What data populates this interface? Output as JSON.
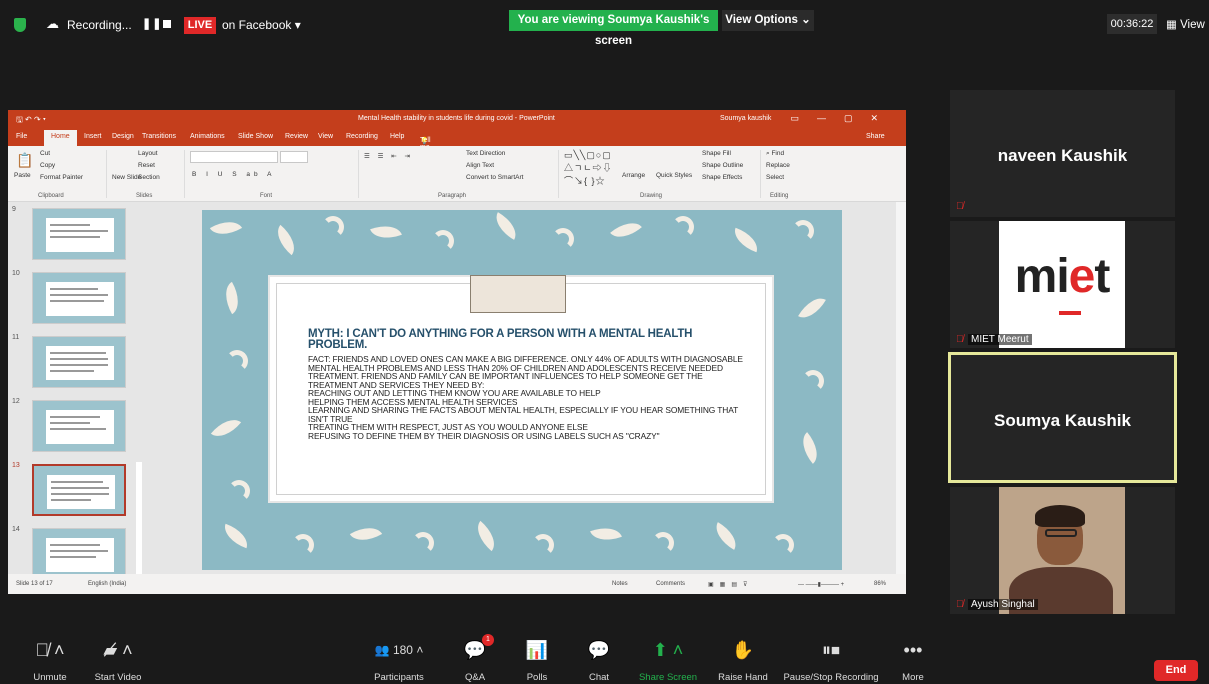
{
  "topbar": {
    "recording_label": "Recording...",
    "live_label": "LIVE",
    "facebook_label": "on Facebook ▾",
    "viewing_banner": "You are viewing Soumya Kaushik's screen",
    "view_options": "View Options ⌄",
    "timer": "00:36:22",
    "view_label": "View"
  },
  "ppt": {
    "doc_title": "Mental Health stability in students life during covid  -  PowerPoint",
    "user": "Soumya kaushik",
    "tabs": [
      "File",
      "Home",
      "Insert",
      "Design",
      "Transitions",
      "Animations",
      "Slide Show",
      "Review",
      "View",
      "Recording",
      "Help"
    ],
    "tell_me": "Tell me what you want to do",
    "share": "Share",
    "ribbon": {
      "cut": "Cut",
      "copy": "Copy",
      "paste": "Paste",
      "format_painter": "Format Painter",
      "new_slide": "New Slide",
      "layout": "Layout",
      "reset": "Reset",
      "section": "Section",
      "text_direction": "Text Direction",
      "align_text": "Align Text",
      "convert_smartart": "Convert to SmartArt",
      "arrange": "Arrange",
      "quick_styles": "Quick Styles",
      "shape_fill": "Shape Fill",
      "shape_outline": "Shape Outline",
      "shape_effects": "Shape Effects",
      "find": "Find",
      "replace": "Replace",
      "select": "Select",
      "groups": [
        "Clipboard",
        "Slides",
        "Font",
        "Paragraph",
        "Drawing",
        "Editing"
      ]
    },
    "slide_numbers": [
      "9",
      "10",
      "11",
      "12",
      "13",
      "14"
    ],
    "slide_title": "MYTH: I CAN'T DO ANYTHING FOR A PERSON WITH A MENTAL HEALTH PROBLEM.",
    "slide_body": [
      "FACT: FRIENDS AND LOVED ONES CAN MAKE A BIG DIFFERENCE. ONLY 44% OF ADULTS WITH DIAGNOSABLE MENTAL HEALTH PROBLEMS AND LESS THAN 20% OF CHILDREN AND ADOLESCENTS RECEIVE NEEDED TREATMENT. FRIENDS AND FAMILY CAN BE IMPORTANT INFLUENCES TO HELP SOMEONE GET THE TREATMENT AND SERVICES THEY NEED BY:",
      "",
      "REACHING OUT AND LETTING THEM KNOW YOU ARE AVAILABLE TO HELP",
      "HELPING THEM ACCESS MENTAL HEALTH SERVICES",
      "LEARNING AND SHARING THE FACTS ABOUT MENTAL HEALTH, ESPECIALLY IF YOU HEAR SOMETHING THAT ISN'T TRUE",
      "TREATING THEM WITH RESPECT, JUST AS YOU WOULD ANYONE ELSE",
      "REFUSING TO DEFINE THEM BY THEIR DIAGNOSIS OR USING LABELS SUCH AS \"CRAZY\""
    ],
    "status": {
      "slide_count": "Slide 13 of 17",
      "language": "English (India)",
      "notes": "Notes",
      "comments": "Comments",
      "zoom": "86%"
    }
  },
  "participants": {
    "tile1_name": "naveen Kaushik",
    "tile2_logo": "mi",
    "tile2_logo_end": "t",
    "tile2_caption": "MIET Meerut",
    "tile3_name": "Soumya Kaushik",
    "tile4_caption": "Ayush Singhal"
  },
  "bottom": {
    "unmute": "Unmute",
    "start_video": "Start Video",
    "participants": "Participants",
    "participant_count": "180",
    "qa": "Q&A",
    "qa_badge": "1",
    "polls": "Polls",
    "chat": "Chat",
    "share_screen": "Share Screen",
    "raise_hand": "Raise Hand",
    "pause_recording": "Pause/Stop Recording",
    "more": "More",
    "end": "End"
  },
  "colors": {
    "ppt_accent": "#c43e1c",
    "live_red": "#e02828",
    "viewing_green": "#23b14d",
    "active_speaker": "#e6e89a",
    "slide_bg": "#8cb9c4"
  }
}
